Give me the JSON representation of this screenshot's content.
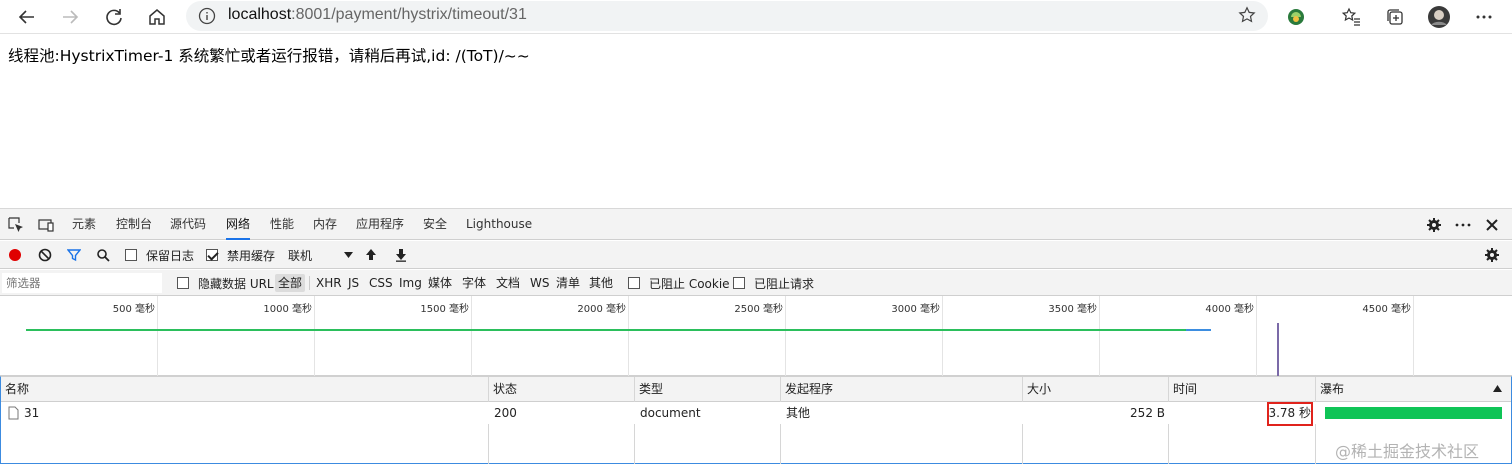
{
  "browser": {
    "url_host": "localhost",
    "url_rest": ":8001/payment/hystrix/timeout/31",
    "icons": [
      "back-icon",
      "forward-icon",
      "reload-icon",
      "home-icon",
      "info-icon",
      "star-icon",
      "extension-icon",
      "favorites-icon",
      "collections-icon",
      "profile-avatar",
      "more-icon"
    ]
  },
  "page": {
    "message": "线程池:HystrixTimer-1 系统繁忙或者运行报错，请稍后再试,id: /(ToT)/~~"
  },
  "devtools": {
    "tabs": [
      "元素",
      "控制台",
      "源代码",
      "网络",
      "性能",
      "内存",
      "应用程序",
      "安全",
      "Lighthouse"
    ],
    "active_tab": "网络",
    "controls": {
      "preserve_log": "保留日志",
      "disable_cache": "禁用缓存",
      "disable_cache_checked": true,
      "preserve_log_checked": false,
      "throttling": "联机"
    },
    "filter": {
      "placeholder": "筛选器",
      "hide_data_urls": "隐藏数据 URL",
      "types": [
        "全部",
        "XHR",
        "JS",
        "CSS",
        "Img",
        "媒体",
        "字体",
        "文档",
        "WS",
        "清单",
        "其他"
      ],
      "active_type": "全部",
      "blocked_cookies": "已阻止 Cookie",
      "blocked_requests": "已阻止请求"
    },
    "overview": {
      "ticks": [
        "500 毫秒",
        "1000 毫秒",
        "1500 毫秒",
        "2000 毫秒",
        "2500 毫秒",
        "3000 毫秒",
        "3500 毫秒",
        "4000 毫秒",
        "4500 毫秒"
      ]
    },
    "table": {
      "columns": [
        "名称",
        "状态",
        "类型",
        "发起程序",
        "大小",
        "时间",
        "瀑布"
      ],
      "rows": [
        {
          "name": "31",
          "status": "200",
          "type": "document",
          "initiator": "其他",
          "size": "252 B",
          "time": "3.78 秒"
        }
      ]
    },
    "colors": {
      "accent": "#1a73e8",
      "waterfall": "#0fc456",
      "highlight": "#e0231c",
      "record": "#e00000",
      "filter": "#1a73e8"
    }
  },
  "watermark": "@稀土掘金技术社区"
}
